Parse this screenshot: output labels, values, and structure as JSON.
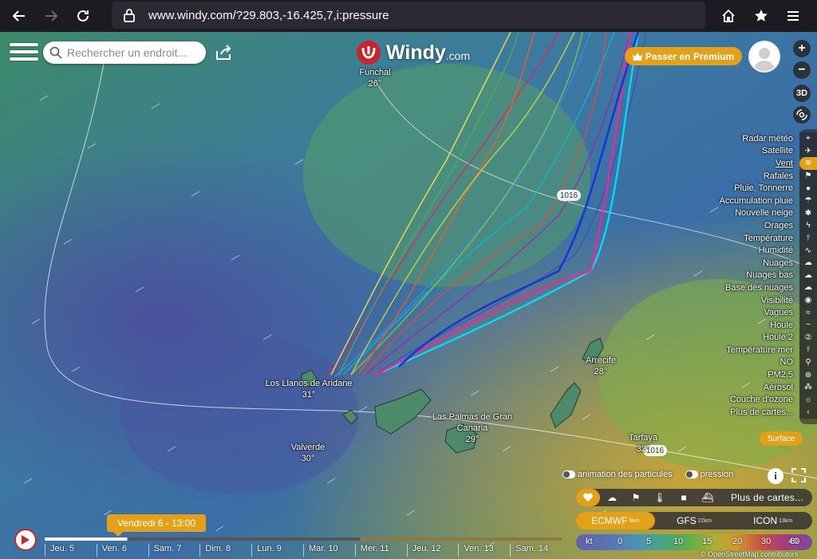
{
  "browser": {
    "url": "www.windy.com/?29.803,-16.425,7,i:pressure",
    "back_icon": "arrow-left-icon",
    "forward_icon": "arrow-right-icon",
    "reload_icon": "reload-icon"
  },
  "search": {
    "placeholder": "Rechercher un endroit..."
  },
  "logo": {
    "name": "Windy",
    "suffix": ".com"
  },
  "premium_label": "Passer en Premium",
  "zoom": {
    "in": "+",
    "out": "−"
  },
  "view_3d": "3D",
  "places": [
    {
      "name": "Funchal",
      "temp": "26°"
    },
    {
      "name": "Arrecife",
      "temp": "28°"
    },
    {
      "name": "Los Llanos de Aridane",
      "temp": "31°"
    },
    {
      "name": "Las Palmas de Gran Canaria",
      "temp": "29°"
    },
    {
      "name": "Valverde",
      "temp": "30°"
    },
    {
      "name": "Tarfaya",
      "temp": "32°"
    }
  ],
  "isobars": [
    "1016",
    "1016"
  ],
  "layers": [
    {
      "label": "Radar météo",
      "icon": "radar-icon"
    },
    {
      "label": "Satellite",
      "icon": "satellite-icon"
    },
    {
      "label": "Vent",
      "icon": "wind-icon",
      "active": true
    },
    {
      "label": "Rafales",
      "icon": "flag-icon"
    },
    {
      "label": "Pluie, Tonnerre",
      "icon": "drop-icon"
    },
    {
      "label": "Accumulation pluie",
      "icon": "rain-cloud-icon"
    },
    {
      "label": "Nouvelle neige",
      "icon": "snowflake-icon"
    },
    {
      "label": "Orages",
      "icon": "thunder-icon"
    },
    {
      "label": "Température",
      "icon": "thermometer-icon"
    },
    {
      "label": "Humidité",
      "icon": "humidity-icon"
    },
    {
      "label": "Nuages",
      "icon": "cloud-icon"
    },
    {
      "label": "Nuages bas",
      "icon": "low-cloud-icon"
    },
    {
      "label": "Base des nuages",
      "icon": "cloud-base-icon"
    },
    {
      "label": "Visibilité",
      "icon": "eye-icon"
    },
    {
      "label": "Vagues",
      "icon": "waves-icon"
    },
    {
      "label": "Houle",
      "icon": "swell-icon"
    },
    {
      "label": "Houle 2",
      "icon": "swell-2-icon"
    },
    {
      "label": "Température mer",
      "icon": "sea-temp-icon"
    },
    {
      "label": "NO",
      "icon": "no2-icon"
    },
    {
      "label": "PM2,5",
      "icon": "pm25-icon"
    },
    {
      "label": "Aérosol",
      "icon": "aerosol-icon"
    },
    {
      "label": "Couche d'ozone",
      "icon": "ozone-icon"
    },
    {
      "label": "Plus de cartes...",
      "icon": "chevron-left-icon"
    }
  ],
  "surface_label": "Surface",
  "toggles": {
    "particles": "animation des particules",
    "pressure": "pression"
  },
  "quick_more": "Plus de cartes...",
  "models": [
    {
      "name": "ECMWF",
      "res": "9km",
      "active": true
    },
    {
      "name": "GFS",
      "res": "22km"
    },
    {
      "name": "ICON",
      "res": "13km"
    }
  ],
  "legend": {
    "unit": "kt",
    "values": [
      "0",
      "5",
      "10",
      "15",
      "20",
      "30",
      "40",
      "60"
    ]
  },
  "attribution": "© OpenStreetMap contributors",
  "timeline": {
    "current": "Vendredi 6 - 13:00",
    "days": [
      "Jeu. 5",
      "Ven. 6",
      "Sam. 7",
      "Dim. 8",
      "Lun. 9",
      "Mar. 10",
      "Mer. 11",
      "Jeu. 12",
      "Ven. 13",
      "Sam. 14"
    ]
  },
  "colors": {
    "accent": "#e3a11a",
    "play": "#c62828"
  }
}
